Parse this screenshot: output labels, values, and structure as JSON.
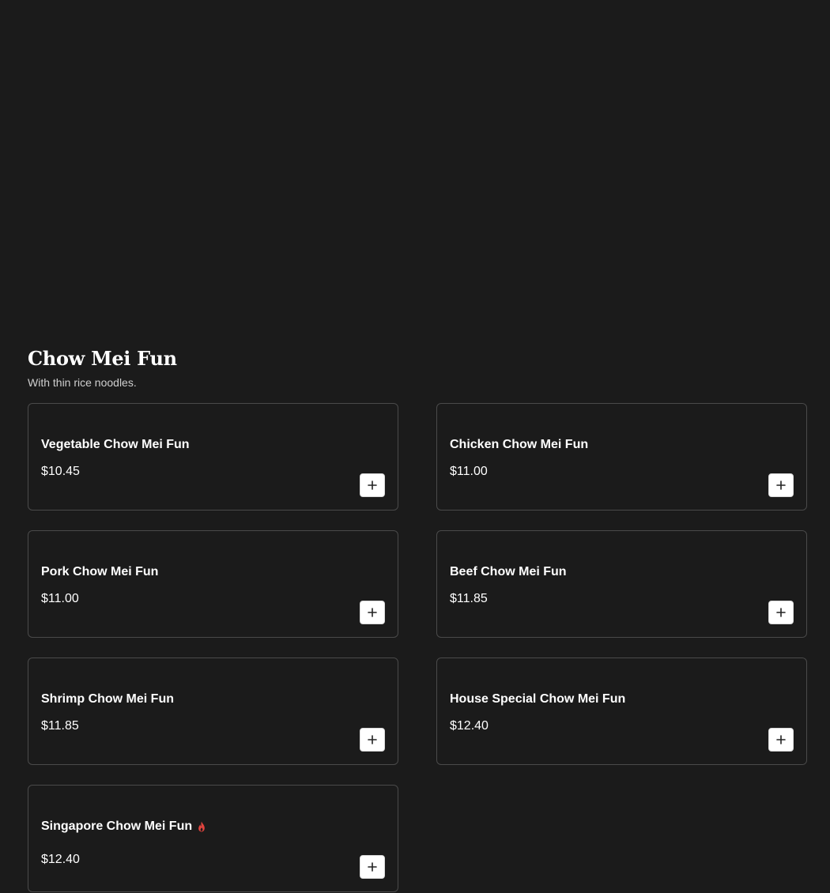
{
  "section": {
    "title": "Chow Mei Fun",
    "subtitle": "With thin rice noodles."
  },
  "items": [
    {
      "name": "Vegetable Chow Mei Fun",
      "price": "$10.45",
      "spicy": false
    },
    {
      "name": "Chicken Chow Mei Fun",
      "price": "$11.00",
      "spicy": false
    },
    {
      "name": "Pork Chow Mei Fun",
      "price": "$11.00",
      "spicy": false
    },
    {
      "name": "Beef Chow Mei Fun",
      "price": "$11.85",
      "spicy": false
    },
    {
      "name": "Shrimp Chow Mei Fun",
      "price": "$11.85",
      "spicy": false
    },
    {
      "name": "House Special Chow Mei Fun",
      "price": "$12.40",
      "spicy": false
    },
    {
      "name": "Singapore Chow Mei Fun",
      "price": "$12.40",
      "spicy": true
    }
  ],
  "icons": {
    "add": "plus-icon",
    "spicy": "flame-icon"
  },
  "colors": {
    "background": "#1b1b1b",
    "card_border": "#4a4a4a",
    "spicy_icon": "#e0443e",
    "add_button": "#ffffff"
  }
}
